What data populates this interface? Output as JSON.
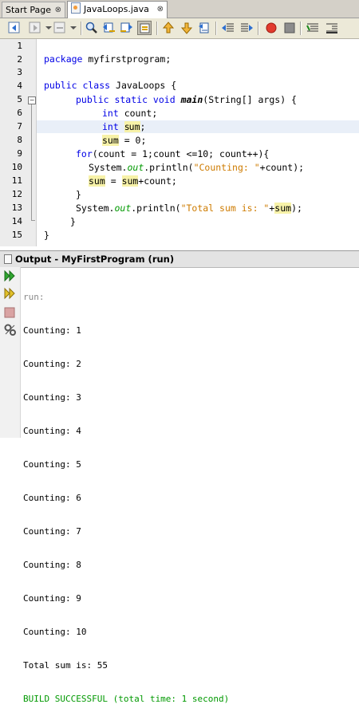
{
  "tabs": [
    {
      "label": "Start Page",
      "close": "⊗"
    },
    {
      "label": "JavaLoops.java",
      "close": "⊗"
    }
  ],
  "toolbar": {
    "icons": [
      "back-icon",
      "forward-disabled-icon",
      "history-icon",
      "find-icon",
      "find-previous-icon",
      "find-next-icon",
      "toggle-highlight-icon",
      "previous-bookmark-icon",
      "next-bookmark-icon",
      "toggle-bookmark-icon",
      "shift-left-icon",
      "shift-right-icon",
      "record-macro-icon",
      "stop-macro-icon",
      "comment-icon",
      "uncomment-icon"
    ]
  },
  "editor": {
    "line_numbers": [
      "1",
      "2",
      "3",
      "4",
      "5",
      "6",
      "7",
      "8",
      "9",
      "10",
      "11",
      "12",
      "13",
      "14",
      "15"
    ],
    "lines": {
      "l2_kw": "package",
      "l2_rest": " myfirstprogram;",
      "l4_kw": "public class",
      "l4_rest": " JavaLoops {",
      "l5_kw": "public static void",
      "l5_method": "main",
      "l5_rest": "(String[] args) {",
      "l6_kw": "int",
      "l6_rest": " count;",
      "l7_kw": "int",
      "l7_a": "s",
      "l7_b": "um",
      "l7_rest": ";",
      "l8_var": "sum",
      "l8_rest": " = 0;",
      "l9_kw": "for",
      "l9_rest": "(count = 1;count <=10; count++){",
      "l10_a": "System.",
      "l10_out": "out",
      "l10_b": ".println(",
      "l10_str": "\"Counting: \"",
      "l10_c": "+count);",
      "l11_var1": "sum",
      "l11_a": " = ",
      "l11_var2": "sum",
      "l11_b": "+count;",
      "l12": "}",
      "l13_a": "System.",
      "l13_out": "out",
      "l13_b": ".println(",
      "l13_str": "\"Total sum is: \"",
      "l13_c": "+",
      "l13_var": "sum",
      "l13_d": ");",
      "l14": "}",
      "l15": "}"
    }
  },
  "output": {
    "title": "Output - MyFirstProgram (run)",
    "lines": [
      "run:",
      "Counting: 1",
      "Counting: 2",
      "Counting: 3",
      "Counting: 4",
      "Counting: 5",
      "Counting: 6",
      "Counting: 7",
      "Counting: 8",
      "Counting: 9",
      "Counting: 10",
      "Total sum is: 55",
      "BUILD SUCCESSFUL (total time: 1 second)"
    ],
    "side_icons": [
      "rerun-icon",
      "rerun-with-options-icon",
      "stop-icon",
      "settings-icon"
    ]
  },
  "colors": {
    "keyword": "#0000e6",
    "string": "#ce7b00",
    "static_field": "#009900",
    "highlight": "#f7f2a8",
    "success": "#009900"
  }
}
